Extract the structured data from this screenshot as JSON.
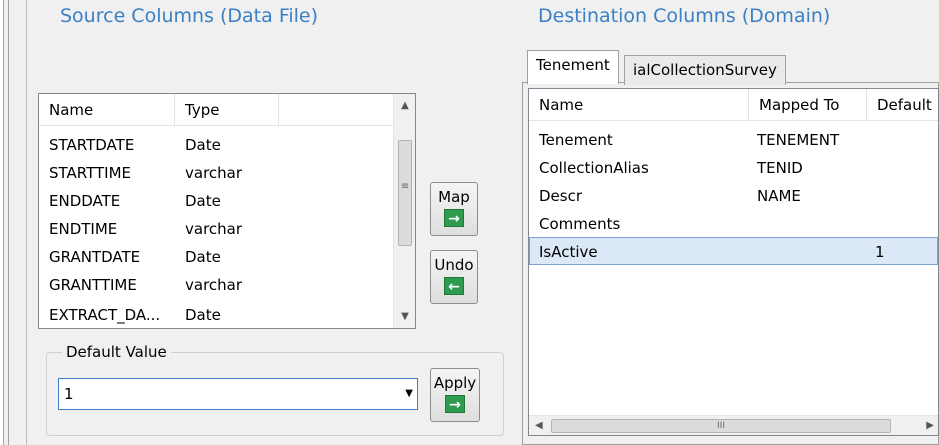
{
  "source": {
    "title": "Source Columns (Data File)",
    "columns": [
      "Name",
      "Type"
    ],
    "rows": [
      {
        "name": "STARTDATE",
        "type": "Date"
      },
      {
        "name": "STARTTIME",
        "type": "varchar"
      },
      {
        "name": "ENDDATE",
        "type": "Date"
      },
      {
        "name": "ENDTIME",
        "type": "varchar"
      },
      {
        "name": "GRANTDATE",
        "type": "Date"
      },
      {
        "name": "GRANTTIME",
        "type": "varchar"
      },
      {
        "name": "EXTRACT_DA...",
        "type": "Date"
      }
    ]
  },
  "buttons": {
    "map": "Map",
    "undo": "Undo",
    "apply": "Apply"
  },
  "default_value": {
    "label": "Default Value",
    "value": "1"
  },
  "destination": {
    "title": "Destination Columns (Domain)",
    "tabs": [
      "Tenement",
      "ialCollectionSurvey"
    ],
    "columns": [
      "Name",
      "Mapped To",
      "Default"
    ],
    "rows": [
      {
        "name": "Tenement",
        "mapped": "TENEMENT",
        "default": ""
      },
      {
        "name": "CollectionAlias",
        "mapped": "TENID",
        "default": ""
      },
      {
        "name": "Descr",
        "mapped": "NAME",
        "default": ""
      },
      {
        "name": "Comments",
        "mapped": "",
        "default": ""
      },
      {
        "name": "IsActive",
        "mapped": "",
        "default": "1"
      }
    ],
    "selected_row": "IsActive"
  },
  "scroll_glyphs": {
    "up": "▲",
    "down": "▼",
    "left": "◀",
    "right": "▶",
    "grip": "≡",
    "hgrip": "III"
  },
  "arrows": {
    "right": "→",
    "left": "←"
  }
}
